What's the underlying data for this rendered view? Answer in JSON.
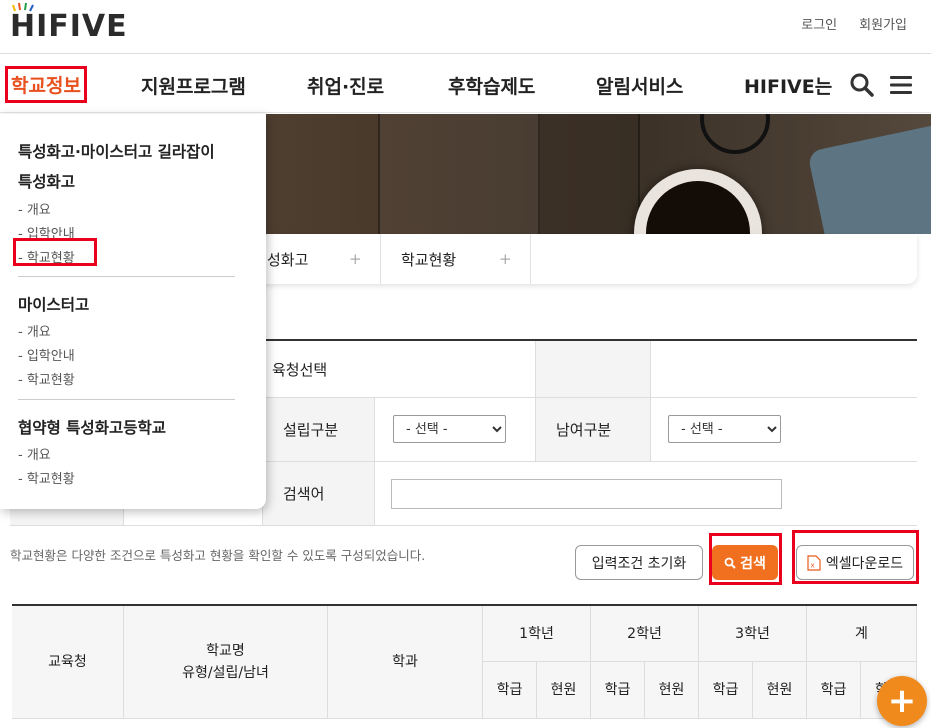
{
  "brand": {
    "logo_text": "HIFIVE"
  },
  "util": {
    "login": "로그인",
    "signup": "회원가입"
  },
  "gnb": {
    "items": [
      "학교정보",
      "지원프로그램",
      "취업·진로",
      "후학습제도",
      "알림서비스",
      "HIFIVE는"
    ],
    "search_icon": "search-icon",
    "menu_icon": "hamburger-menu-icon",
    "accent_color": "#e8501e"
  },
  "tabs": [
    {
      "label": "성화고",
      "icon": "+"
    },
    {
      "label": "학교현황",
      "icon": "+"
    }
  ],
  "form": {
    "row1_value": "육청선택",
    "found_label": "설립구분",
    "found_select": "- 선택 -",
    "gender_label": "남여구분",
    "gender_select": "- 선택 -",
    "keyword_label": "검색어",
    "keyword_value": ""
  },
  "description": "학교현황은 다양한 조건으로 특성화고 현황을 확인할 수 있도록 구성되었습니다.",
  "buttons": {
    "reset": "입력조건 초기화",
    "search": "검색",
    "excel": "엑셀다운로드"
  },
  "table": {
    "col_office": "교육청",
    "col_school_line1": "학교명",
    "col_school_line2": "유형/설립/남녀",
    "col_dept": "학과",
    "grades": [
      "1학년",
      "2학년",
      "3학년",
      "계"
    ],
    "sub_class": "학급",
    "sub_students": "현원",
    "sub_last_partial": "학"
  },
  "dropdown": {
    "sections": [
      {
        "title": "특성화고·마이스터고 길라잡이",
        "items": []
      },
      {
        "title": "특성화고",
        "items": [
          "- 개요",
          "- 입학안내",
          "- 학교현황"
        ]
      },
      {
        "title": "마이스터고",
        "items": [
          "- 개요",
          "- 입학안내",
          "- 학교현황"
        ]
      },
      {
        "title": "협약형 특성화고등학교",
        "items": [
          "- 개요",
          "- 학교현황"
        ]
      }
    ]
  },
  "fab": {
    "label": "+"
  },
  "colors": {
    "search_button": "#f07020",
    "highlight": "#e8001c"
  }
}
